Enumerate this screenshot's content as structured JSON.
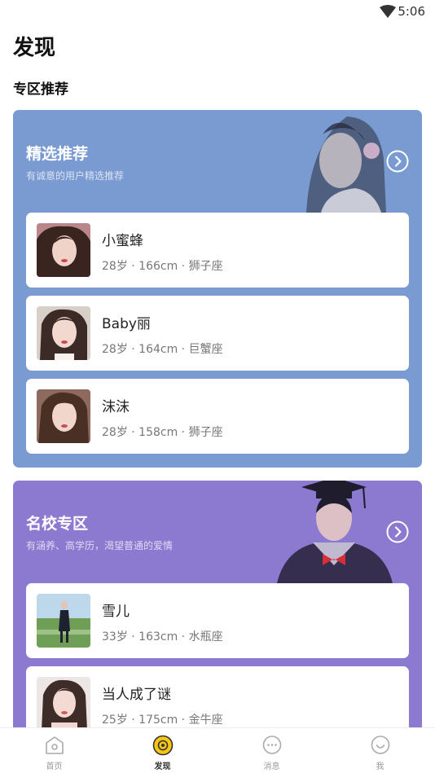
{
  "status_bar": {
    "time": "5:06",
    "icons": [
      "wifi-icon"
    ]
  },
  "page": {
    "title": "发现"
  },
  "section": {
    "title": "专区推荐"
  },
  "zones": [
    {
      "title": "精选推荐",
      "subtitle": "有诚意的用户精选推荐",
      "color": "#7a9bd1",
      "more_icon": "chevron-right-circle-icon",
      "users": [
        {
          "name": "小蜜蜂",
          "meta": "28岁 · 166cm · 狮子座"
        },
        {
          "name": "Baby丽",
          "meta": "28岁 · 164cm · 巨蟹座"
        },
        {
          "name": "沫沫",
          "meta": "28岁 · 158cm · 狮子座"
        }
      ]
    },
    {
      "title": "名校专区",
      "subtitle": "有涵养、高学历，渴望普通的爱情",
      "color": "#8b7ad0",
      "more_icon": "chevron-right-circle-icon",
      "users": [
        {
          "name": "雪儿",
          "meta": "33岁 · 163cm · 水瓶座"
        },
        {
          "name": "当人成了谜",
          "meta": "25岁 · 175cm · 金牛座"
        }
      ]
    }
  ],
  "tabs": [
    {
      "label": "首页",
      "icon": "home-icon",
      "active": false
    },
    {
      "label": "发现",
      "icon": "discover-icon",
      "active": true
    },
    {
      "label": "消息",
      "icon": "message-icon",
      "active": false
    },
    {
      "label": "我",
      "icon": "profile-icon",
      "active": false
    }
  ],
  "colors": {
    "accent": "#f5c518",
    "tab_active": "#333333",
    "tab_inactive": "#999999"
  }
}
